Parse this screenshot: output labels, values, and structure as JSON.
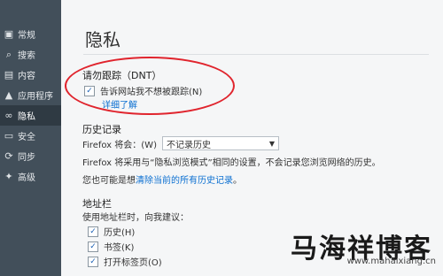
{
  "sidebar": {
    "items": [
      {
        "label": "常规",
        "icon": "home-icon",
        "glyph": "▣",
        "active": false
      },
      {
        "label": "搜索",
        "icon": "search-icon",
        "glyph": "⌕",
        "active": false
      },
      {
        "label": "内容",
        "icon": "document-icon",
        "glyph": "▤",
        "active": false
      },
      {
        "label": "应用程序",
        "icon": "rocket-icon",
        "glyph": "▲",
        "active": false
      },
      {
        "label": "隐私",
        "icon": "mask-icon",
        "glyph": "∞",
        "active": true
      },
      {
        "label": "安全",
        "icon": "lock-icon",
        "glyph": "▭",
        "active": false
      },
      {
        "label": "同步",
        "icon": "sync-icon",
        "glyph": "⟳",
        "active": false
      },
      {
        "label": "高级",
        "icon": "wizard-icon",
        "glyph": "✦",
        "active": false
      }
    ]
  },
  "page": {
    "title": "隐私"
  },
  "dnt": {
    "heading": "请勿跟踪（DNT）",
    "checkbox_label": "告诉网站我不想被跟踪(N)",
    "checked": true,
    "learn_more": "详细了解"
  },
  "history": {
    "heading": "历史记录",
    "firefox_will_label": "Firefox 将会：(W)",
    "select_value": "不记录历史",
    "desc": "Firefox 将采用与“隐私浏览模式”相同的设置，不会记录您浏览网络的历史。",
    "clear_prefix": "您也可能是想",
    "clear_link": "清除当前的所有历史记录",
    "clear_suffix": "。"
  },
  "location_bar": {
    "heading": "地址栏",
    "desc": "使用地址栏时，向我建议：",
    "options": [
      {
        "label": "历史(H)",
        "checked": true
      },
      {
        "label": "书签(K)",
        "checked": true
      },
      {
        "label": "打开标签页(O)",
        "checked": true
      }
    ]
  },
  "watermark": {
    "text": "马海祥博客",
    "url": "www.mahaixiang.cn"
  },
  "colors": {
    "sidebar_bg": "#424f5a",
    "accent": "#0b6fd1",
    "annotation": "#e0242d"
  }
}
